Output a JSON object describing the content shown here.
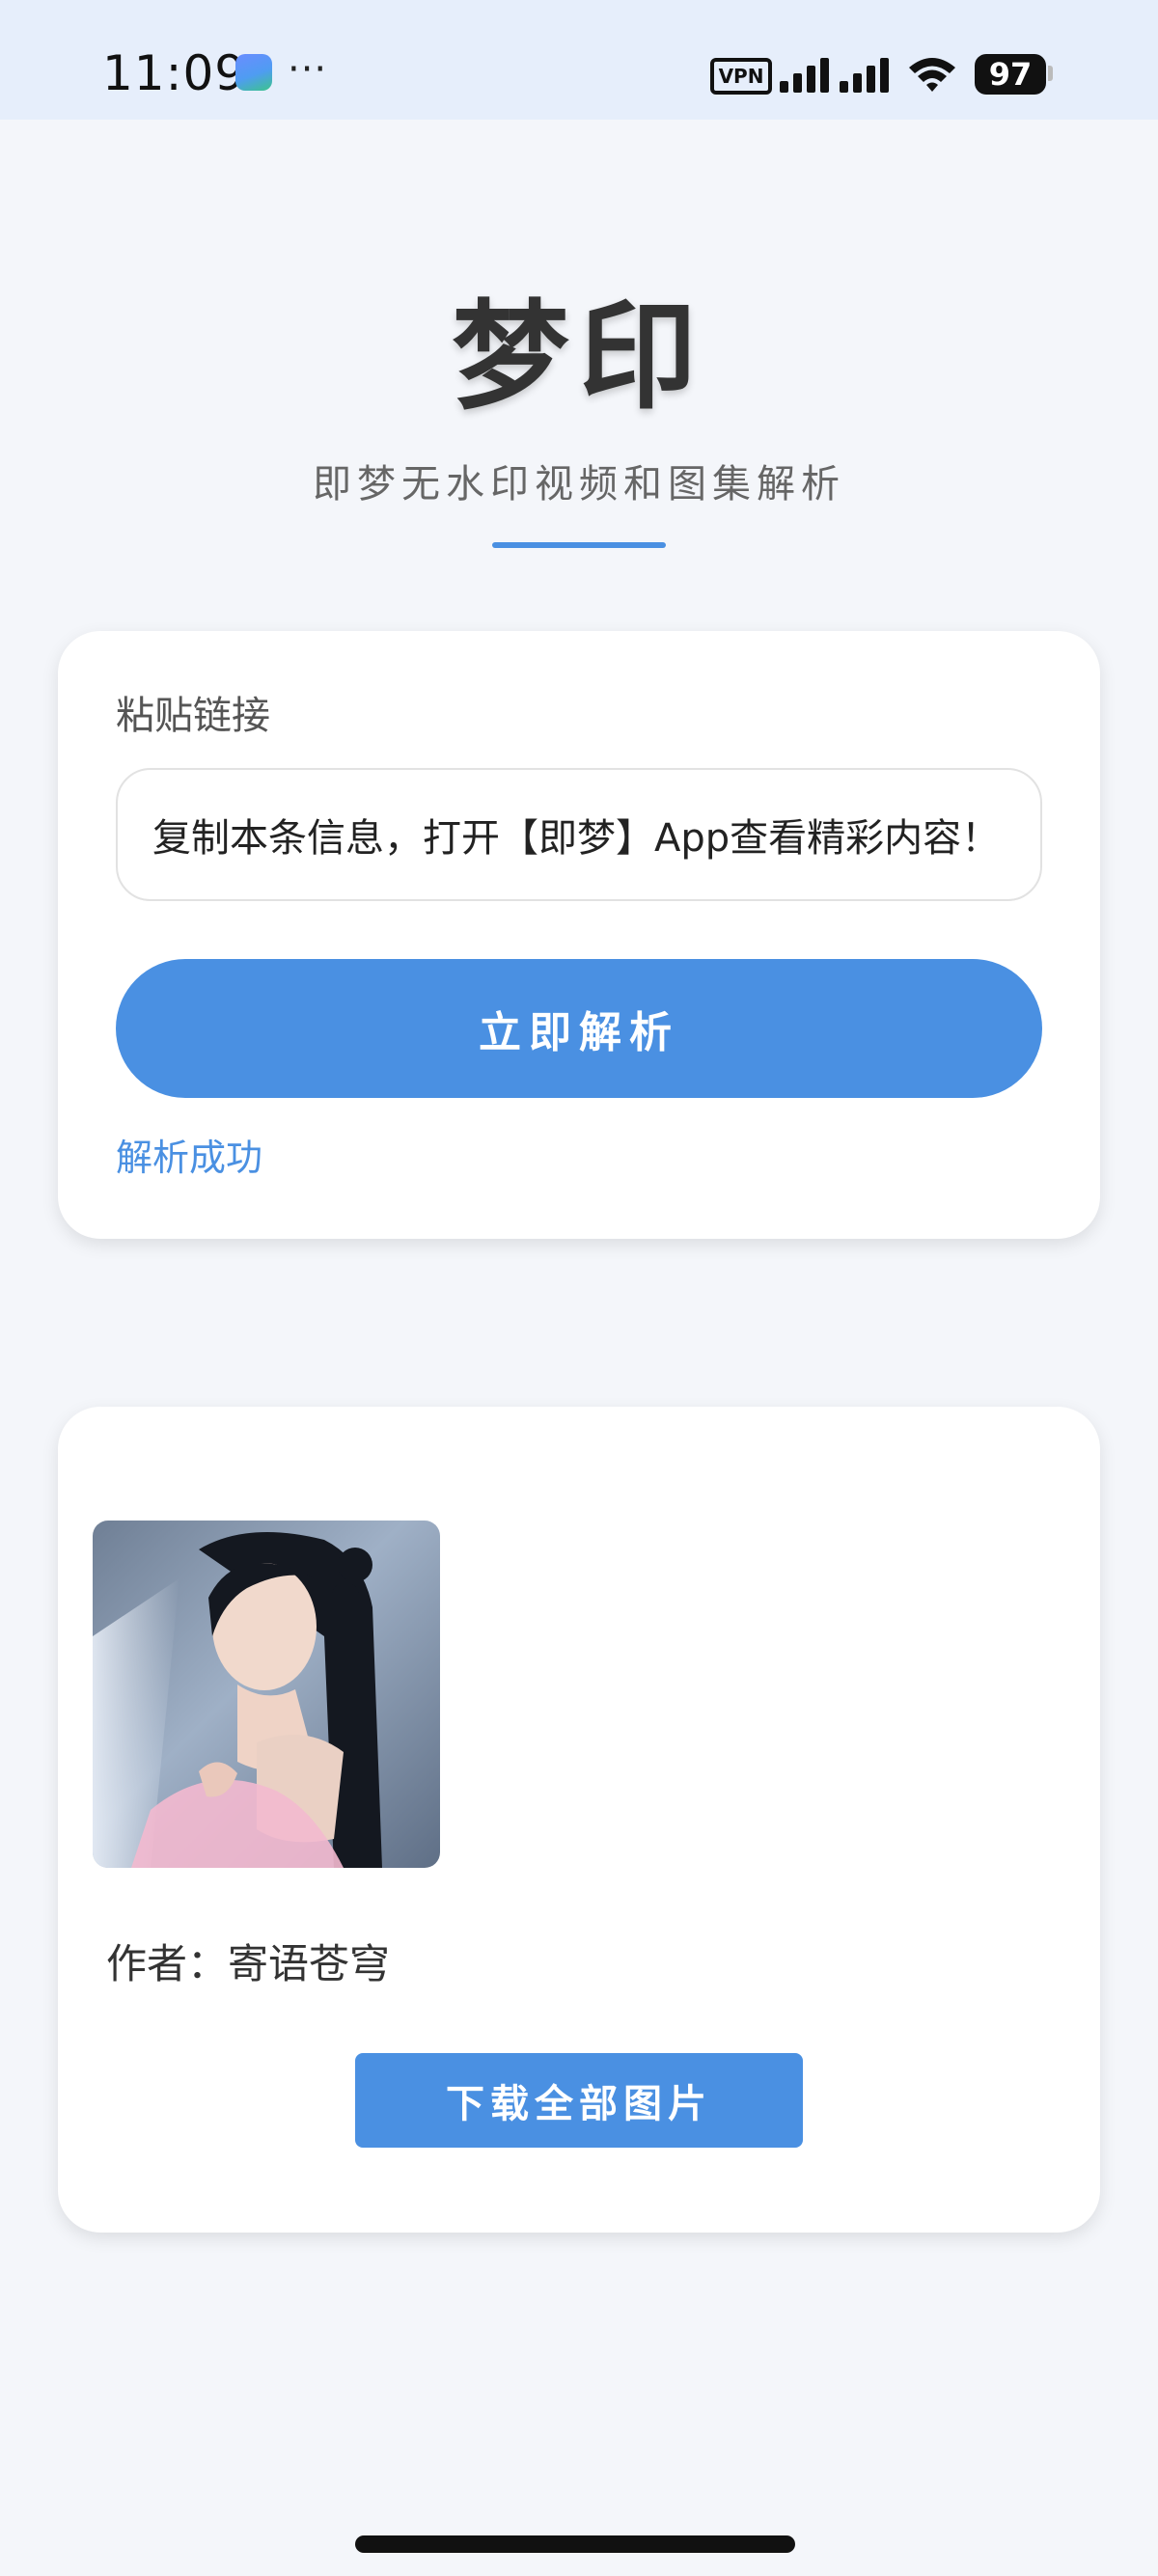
{
  "status_bar": {
    "time": "11:09",
    "more": "···",
    "vpn": "VPN",
    "battery": "97",
    "icons": [
      "app-notification-icon",
      "vpn-icon",
      "signal-icon",
      "wifi-icon",
      "battery-icon"
    ]
  },
  "header": {
    "title": "梦印",
    "subtitle": "即梦无水印视频和图集解析"
  },
  "parse_card": {
    "label": "粘贴链接",
    "input_value": "复制本条信息，打开【即梦】App查看精彩内容！",
    "button_label": "立即解析",
    "status": "解析成功"
  },
  "result_card": {
    "author_line": "作者：寄语苍穹",
    "download_label": "下载全部图片"
  },
  "colors": {
    "accent": "#4a90e2",
    "page_bg": "#f4f6fa",
    "status_bar_bg": "#e6eefb"
  }
}
